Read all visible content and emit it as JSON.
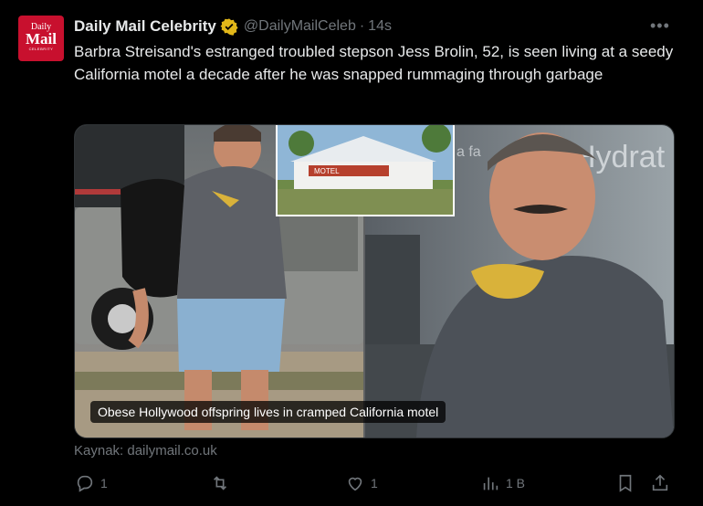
{
  "account": {
    "avatar_line1": "Daily",
    "avatar_line2": "Mail",
    "avatar_line3": "CELEBRITY",
    "name": "Daily Mail Celebrity",
    "handle": "@DailyMailCeleb",
    "separator": "·",
    "time": "14s",
    "verified_icon": "verified-gold-badge-icon",
    "verified_color": "#e2b719"
  },
  "more_label": "•••",
  "text": "Barbra Streisand's estranged troubled stepson Jess Brolin, 52, is seen living at a seedy California motel a decade after he was snapped rummaging through garbage",
  "media": {
    "caption": "Obese Hollywood offspring lives in cramped California motel",
    "motel_sign": "MOTEL",
    "wall_sign": "Hydrat",
    "wall_sign_left": "a fa"
  },
  "source": "Kaynak: dailymail.co.uk",
  "actions": {
    "reply_count": "1",
    "repost_count": "",
    "like_count": "1",
    "views_count": "1 B"
  },
  "colors": {
    "background": "#000000",
    "text": "#e7e9ea",
    "muted": "#71767b",
    "brand_red": "#c8102e"
  }
}
